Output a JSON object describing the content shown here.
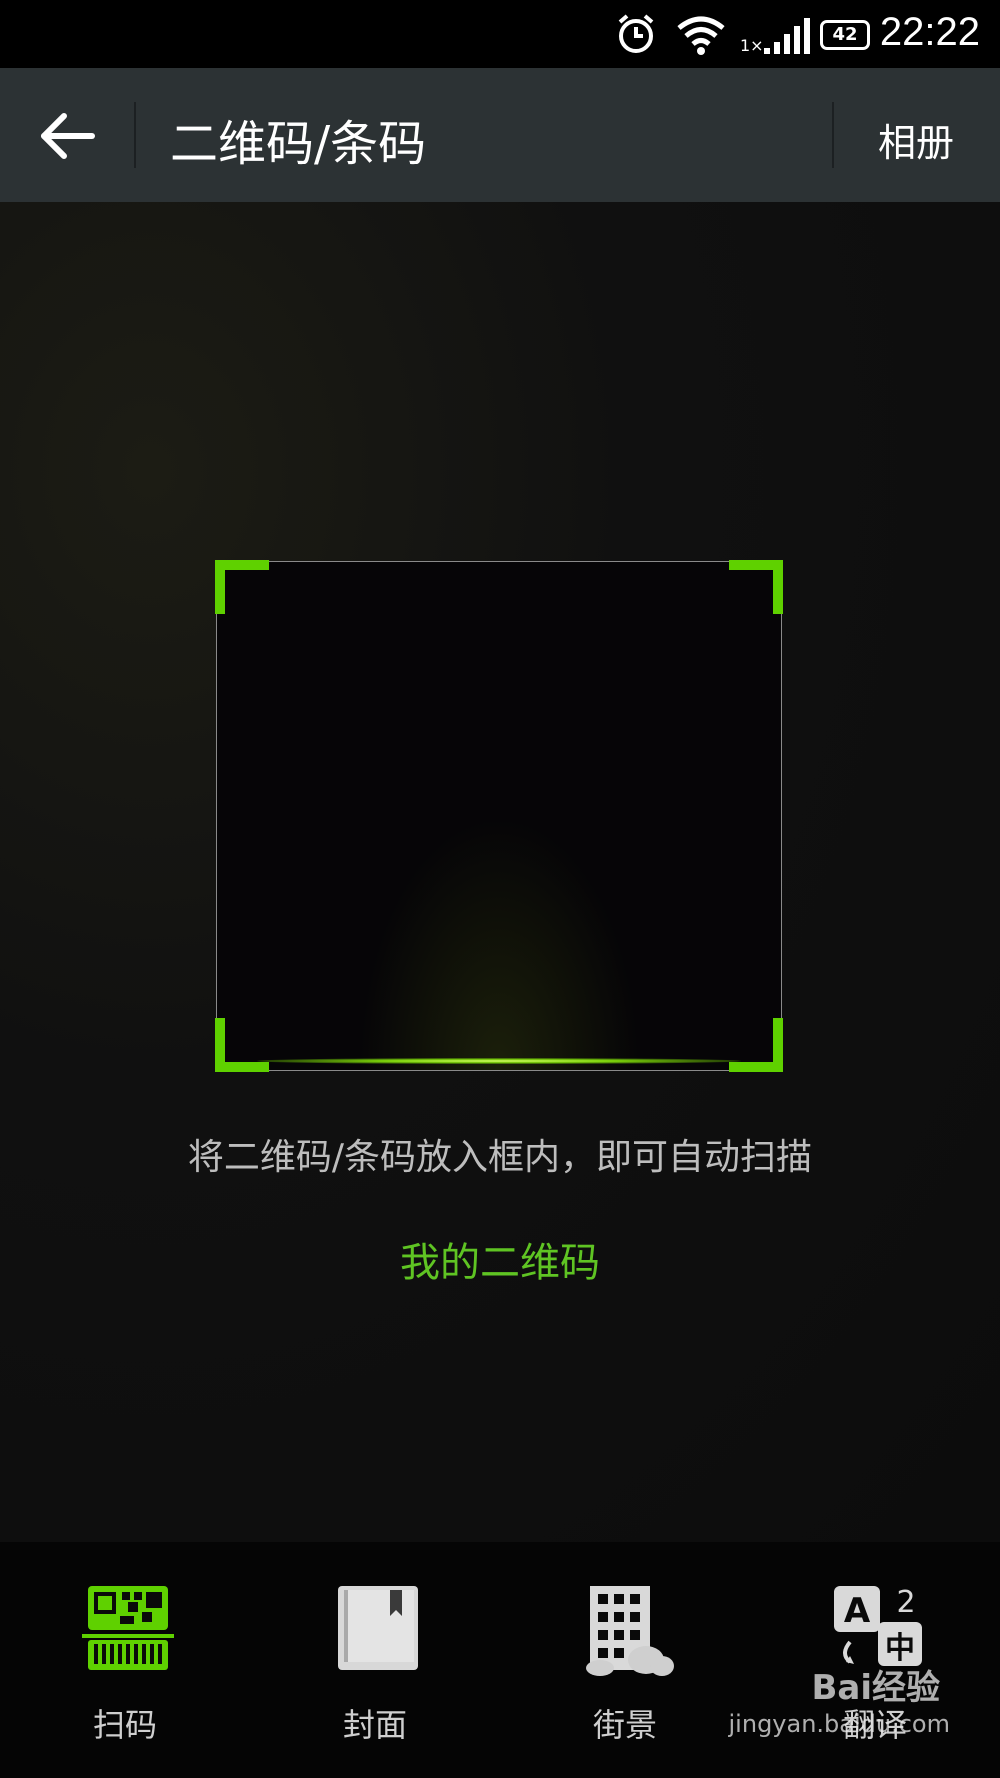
{
  "status_bar": {
    "time": "22:22",
    "battery": "42",
    "signal_label": "1×"
  },
  "app_bar": {
    "title": "二维码/条码",
    "album_label": "相册"
  },
  "scanner": {
    "hint": "将二维码/条码放入框内，即可自动扫描",
    "my_qr_label": "我的二维码"
  },
  "tabs": [
    {
      "label": "扫码",
      "icon": "qr-scan-icon",
      "active": true
    },
    {
      "label": "封面",
      "icon": "book-cover-icon",
      "active": false
    },
    {
      "label": "街景",
      "icon": "building-icon",
      "active": false
    },
    {
      "label": "翻译",
      "icon": "translate-icon",
      "active": false
    }
  ],
  "watermark": {
    "brand": "Bai经验",
    "url": "jingyan.baidu.com"
  },
  "colors": {
    "accent_green": "#5fd100",
    "appbar_bg": "#2c3234"
  }
}
